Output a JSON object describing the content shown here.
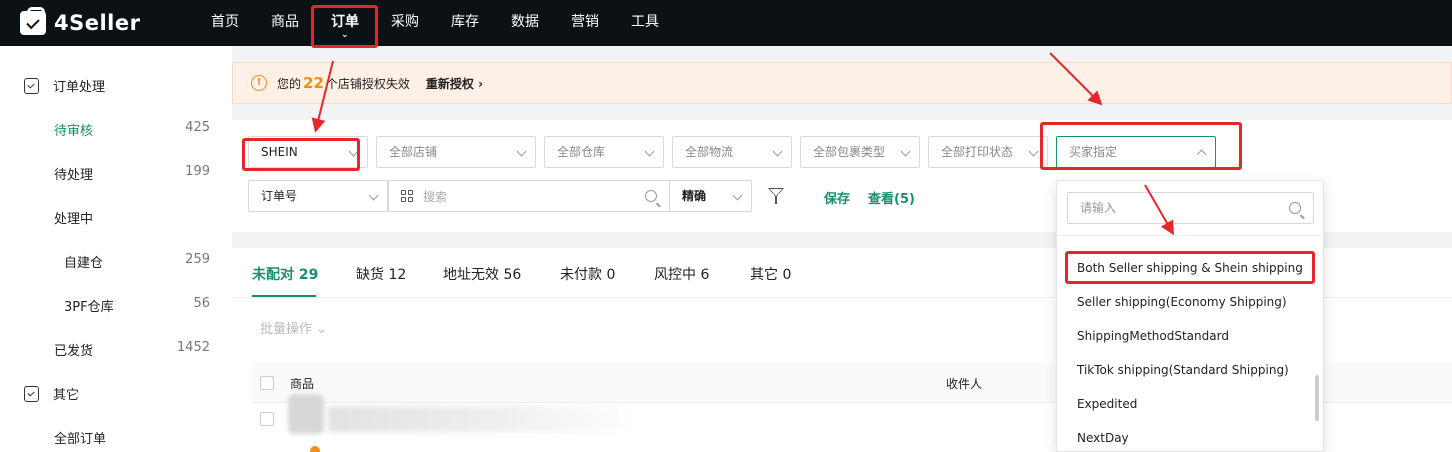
{
  "brand": {
    "name": "4Seller"
  },
  "nav": {
    "items": [
      "首页",
      "商品",
      "订单",
      "采购",
      "库存",
      "数据",
      "营销",
      "工具"
    ],
    "active_caret": "⌄"
  },
  "sidebar": {
    "group1": "订单处理",
    "items": [
      {
        "label": "待审核",
        "count": "425"
      },
      {
        "label": "待处理",
        "count": "199"
      },
      {
        "label": "处理中",
        "count": ""
      },
      {
        "label": "自建仓",
        "count": "259"
      },
      {
        "label": "3PF仓库",
        "count": "56"
      },
      {
        "label": "已发货",
        "count": "1452"
      }
    ],
    "group2": "其它",
    "all_orders": "全部订单"
  },
  "notice": {
    "prefix": "您的",
    "count": "22",
    "suffix": "个店铺授权失效",
    "action": "重新授权 ›"
  },
  "filters": {
    "platform": "SHEIN",
    "store": "全部店铺",
    "warehouse": "全部仓库",
    "logistics": "全部物流",
    "package_type": "全部包裹类型",
    "print_status": "全部打印状态",
    "buyer_specified": "买家指定",
    "order_no": "订单号",
    "search_placeholder": "搜索",
    "match": "精确",
    "save": "保存",
    "view": "查看(5)"
  },
  "tabs": [
    {
      "label": "未配对 29"
    },
    {
      "label": "缺货 12"
    },
    {
      "label": "地址无效 56"
    },
    {
      "label": "未付款 0"
    },
    {
      "label": "风控中 6"
    },
    {
      "label": "其它 0"
    }
  ],
  "batch": "批量操作 ⌄",
  "table": {
    "col_product": "商品",
    "col_recipient": "收件人"
  },
  "dropdown": {
    "placeholder": "请输入",
    "options": [
      "Both Seller shipping & Shein shipping",
      "Seller shipping(Economy Shipping)",
      "ShippingMethodStandard",
      "TikTok shipping(Standard Shipping)",
      "Expedited",
      "NextDay"
    ]
  },
  "colors": {
    "accent": "#1a8f6e",
    "annotation": "#e8262a",
    "warning": "#f08c1c",
    "nav_bg": "#0b1115"
  }
}
